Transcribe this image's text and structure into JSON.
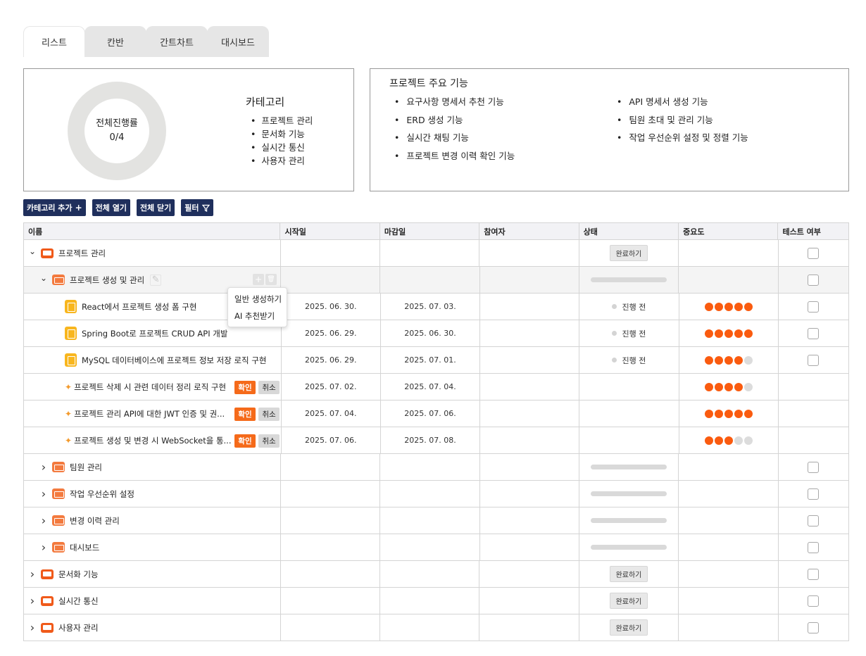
{
  "tabs": [
    {
      "label": "리스트",
      "active": true
    },
    {
      "label": "칸반"
    },
    {
      "label": "간트차트"
    },
    {
      "label": "대시보드"
    }
  ],
  "summary": {
    "progress_label": "전체진행률",
    "progress_value": "0/4",
    "category_title": "카테고리",
    "categories": [
      "프로젝트 관리",
      "문서화 기능",
      "실시간 통신",
      "사용자 관리"
    ]
  },
  "features": {
    "title": "프로젝트 주요 기능",
    "col1": [
      "요구사항 명세서 추천 기능",
      "ERD 생성 기능",
      "실시간 채팅 기능",
      "프로젝트 변경 이력 확인 기능"
    ],
    "col2": [
      "API 명세서 생성 기능",
      "팀원 초대 및 관리 기능",
      "작업 우선순위 설정 및 정렬 기능"
    ]
  },
  "toolbar": {
    "add_category": "카테고리 추가",
    "add_icon": "+",
    "open_all": "전체 열기",
    "close_all": "전체 닫기",
    "filter": "필터",
    "filter_icon": "funnel-icon"
  },
  "table": {
    "headers": [
      "이름",
      "시작일",
      "마감일",
      "참여자",
      "상태",
      "중요도",
      "테스트 여부"
    ],
    "done_button": "완료하기",
    "confirm_label": "확인",
    "cancel_label": "취소",
    "rows": [
      {
        "name": "프로젝트 관리"
      },
      {
        "name": "프로젝트 생성 및 관리"
      },
      {
        "name": "React에서 프로젝트 생성 폼 구현",
        "start": "2025. 06. 30.",
        "end": "2025. 07. 03.",
        "status": "진행 전",
        "importance": 5
      },
      {
        "name": "Spring Boot로 프로젝트 CRUD API 개발",
        "start": "2025. 06. 29.",
        "end": "2025. 06. 30.",
        "status": "진행 전",
        "importance": 5
      },
      {
        "name": "MySQL 데이터베이스에 프로젝트 정보 저장 로직 구현",
        "start": "2025. 06. 29.",
        "end": "2025. 07. 01.",
        "status": "진행 전",
        "importance": 4
      },
      {
        "name": "프로젝트 삭제 시 관련 데이터 정리 로직 구현",
        "start": "2025. 07. 02.",
        "end": "2025. 07. 04.",
        "importance": 4
      },
      {
        "name": "프로젝트 관리 API에 대한 JWT 인증 및 권...",
        "start": "2025. 07. 04.",
        "end": "2025. 07. 06.",
        "importance": 5
      },
      {
        "name": "프로젝트 생성 및 변경 시 WebSocket을 통...",
        "start": "2025. 07. 06.",
        "end": "2025. 07. 08.",
        "importance": 3
      },
      {
        "name": "팀원 관리"
      },
      {
        "name": "작업 우선순위 설정"
      },
      {
        "name": "변경 이력 관리"
      },
      {
        "name": "대시보드"
      },
      {
        "name": "문서화 기능"
      },
      {
        "name": "실시간 통신"
      },
      {
        "name": "사용자 관리"
      }
    ]
  },
  "popup": {
    "items": [
      "일반 생성하기",
      "AI 추천받기"
    ]
  },
  "colors": {
    "navy": "#1f2f5c",
    "orange": "#fa5b0f",
    "folder": "#f37a3e",
    "doc": "#f8b61e"
  }
}
